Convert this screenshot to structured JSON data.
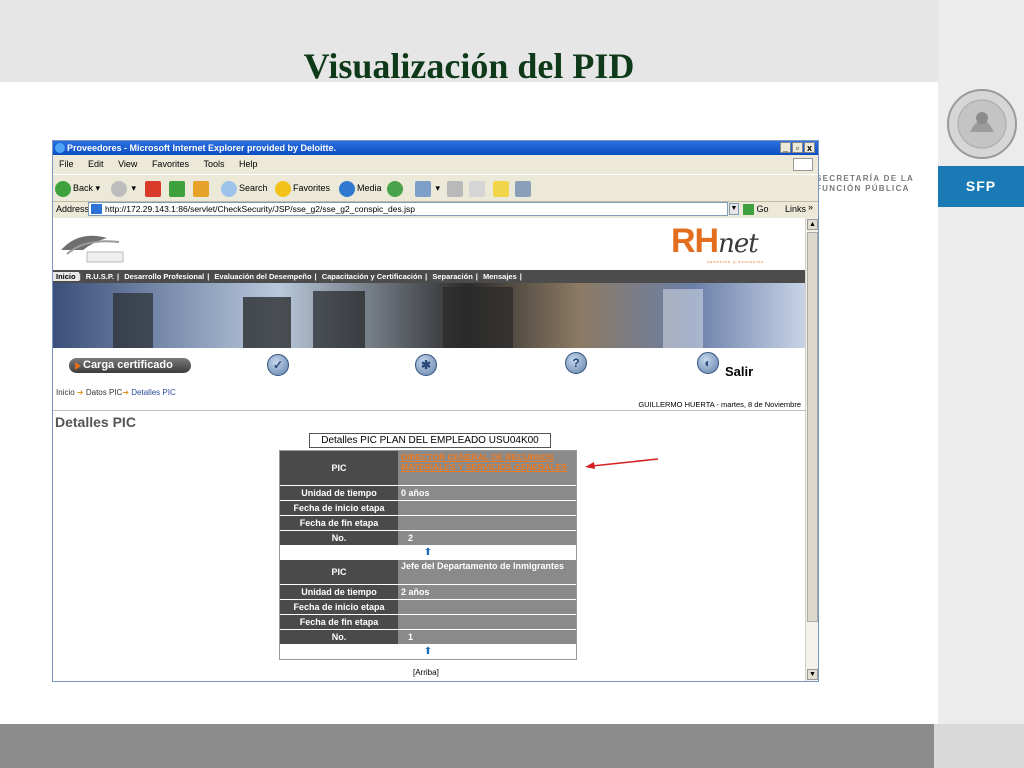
{
  "slide": {
    "title": "Visualización del PID",
    "secretaria": "SECRETARÍA DE LA\nFUNCIÓN PÚBLICA",
    "sfp_badge": "SFP",
    "colors": {
      "title": "#0f3a1a",
      "badge": "#1a7ab5",
      "accent": "#e36f1e"
    }
  },
  "browser": {
    "title": "Proveedores - Microsoft Internet Explorer provided by Deloitte.",
    "window_buttons": [
      "_",
      "▫",
      "x"
    ],
    "menu": [
      "File",
      "Edit",
      "View",
      "Favorites",
      "Tools",
      "Help"
    ],
    "toolbar": {
      "back": "Back",
      "search": "Search",
      "favorites": "Favorites",
      "media": "Media"
    },
    "address": {
      "label": "Address",
      "url": "http://172.29.143.1:86/servlet/CheckSecurity/JSP/sse_g2/sse_g2_conspic_des.jsp",
      "go": "Go",
      "links": "Links"
    }
  },
  "site": {
    "logo_text": "RH",
    "logo_script": "net",
    "logo_tag": "conexión y evolución",
    "nav": [
      "Inicio",
      "R.U.S.P.",
      "Desarrollo Profesional",
      "Evaluación del Desempeño",
      "Capacitación y Certificación",
      "Separación",
      "Mensajes"
    ],
    "carga_button": "Carga certificado",
    "salir": "Salir",
    "breadcrumb": [
      "Inicio",
      "Datos PIC",
      "Detalles PIC"
    ],
    "userline": "GUILLERMO HUERTA - martes, 8 de Noviembre",
    "heading": "Detalles PIC",
    "plan_caption": "Detalles PIC PLAN DEL EMPLEADO USU04K00",
    "labels": {
      "pic": "PIC",
      "unidad": "Unidad de tiempo",
      "inicio": "Fecha de inicio etapa",
      "fin": "Fecha de fin etapa",
      "no": "No."
    },
    "entries": [
      {
        "pic": "DIRECTOR GENERAL DE RECURSOS MATERIALES Y SERVICIOS GENERALES",
        "unidad": "0 años",
        "inicio": "",
        "fin": "",
        "no": "2"
      },
      {
        "pic": "Jefe del Departamento de Inmigrantes",
        "unidad": "2 años",
        "inicio": "",
        "fin": "",
        "no": "1"
      }
    ],
    "up_glyph": "⬆",
    "arriba": "[Arriba]"
  }
}
